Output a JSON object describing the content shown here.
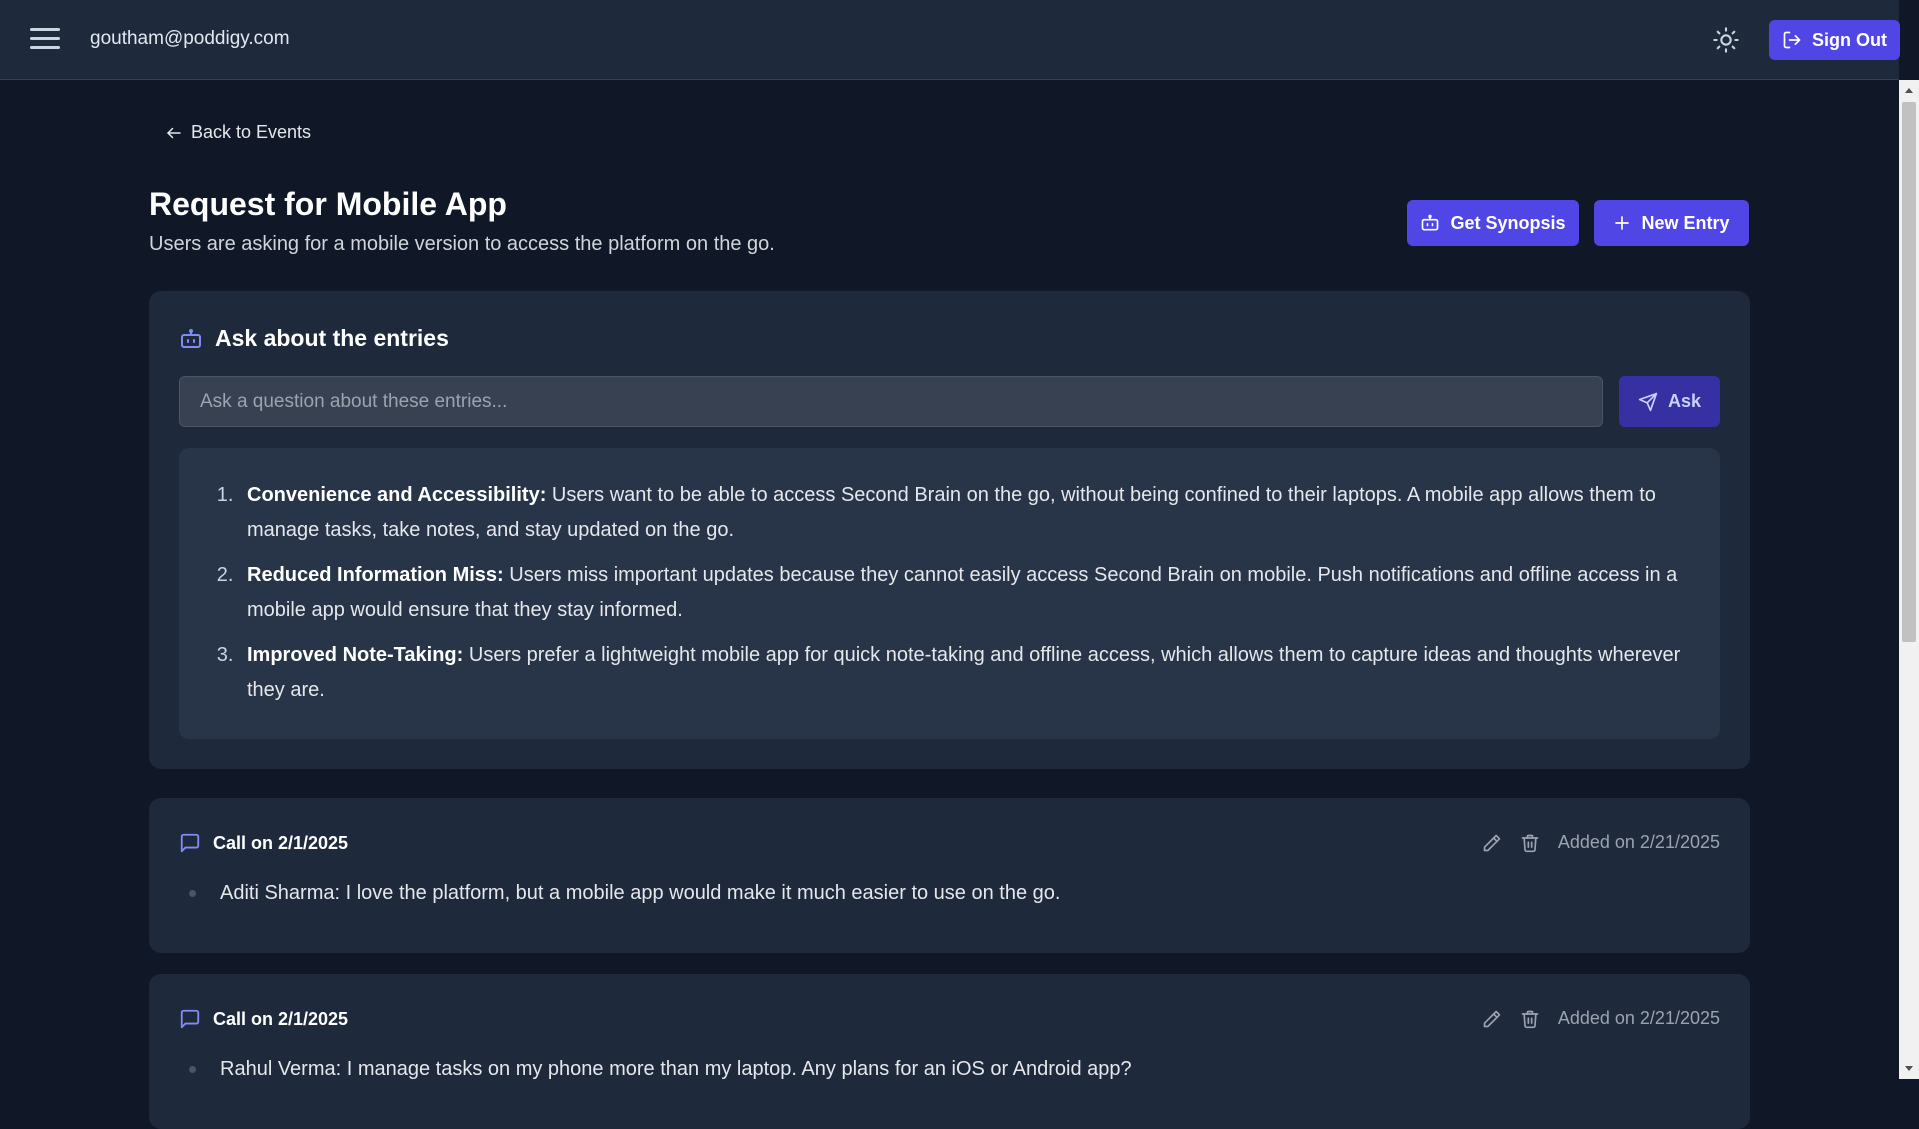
{
  "header": {
    "user_email": "goutham@poddigy.com",
    "sign_out_label": "Sign Out"
  },
  "nav": {
    "back_label": "Back to Events"
  },
  "event": {
    "title": "Request for Mobile App",
    "description": "Users are asking for a mobile version to access the platform on the go."
  },
  "actions": {
    "synopsis_label": "Get Synopsis",
    "new_entry_label": "New Entry"
  },
  "ask": {
    "heading": "Ask about the entries",
    "placeholder": "Ask a question about these entries...",
    "button_label": "Ask",
    "answers": [
      {
        "heading": "Convenience and Accessibility:",
        "text": " Users want to be able to access Second Brain on the go, without being confined to their laptops. A mobile app allows them to manage tasks, take notes, and stay updated on the go."
      },
      {
        "heading": "Reduced Information Miss:",
        "text": " Users miss important updates because they cannot easily access Second Brain on mobile. Push notifications and offline access in a mobile app would ensure that they stay informed."
      },
      {
        "heading": "Improved Note-Taking:",
        "text": " Users prefer a lightweight mobile app for quick note-taking and offline access, which allows them to capture ideas and thoughts wherever they are."
      }
    ]
  },
  "entries": [
    {
      "title": "Call on 2/1/2025",
      "added": "Added on 2/21/2025",
      "text": "Aditi Sharma: I love the platform, but a mobile app would make it much easier to use on the go."
    },
    {
      "title": "Call on 2/1/2025",
      "added": "Added on 2/21/2025",
      "text": "Rahul Verma: I manage tasks on my phone more than my laptop. Any plans for an iOS or Android app?"
    }
  ],
  "colors": {
    "accent": "#4f46e5",
    "background": "#101828",
    "card": "#1e293b"
  }
}
